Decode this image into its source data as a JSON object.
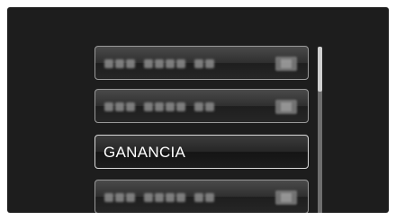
{
  "menu": {
    "items": [
      {
        "label": "",
        "obscured": true
      },
      {
        "label": "",
        "obscured": true
      },
      {
        "label": "GANANCIA",
        "selected": true
      },
      {
        "label": "",
        "obscured": true
      }
    ]
  },
  "colors": {
    "background": "#1d1d1d",
    "item_border": "#9a9a9a",
    "selected_border": "#d8d8d8",
    "text": "#ffffff"
  },
  "scroll": {
    "position_fraction": 0.0
  }
}
